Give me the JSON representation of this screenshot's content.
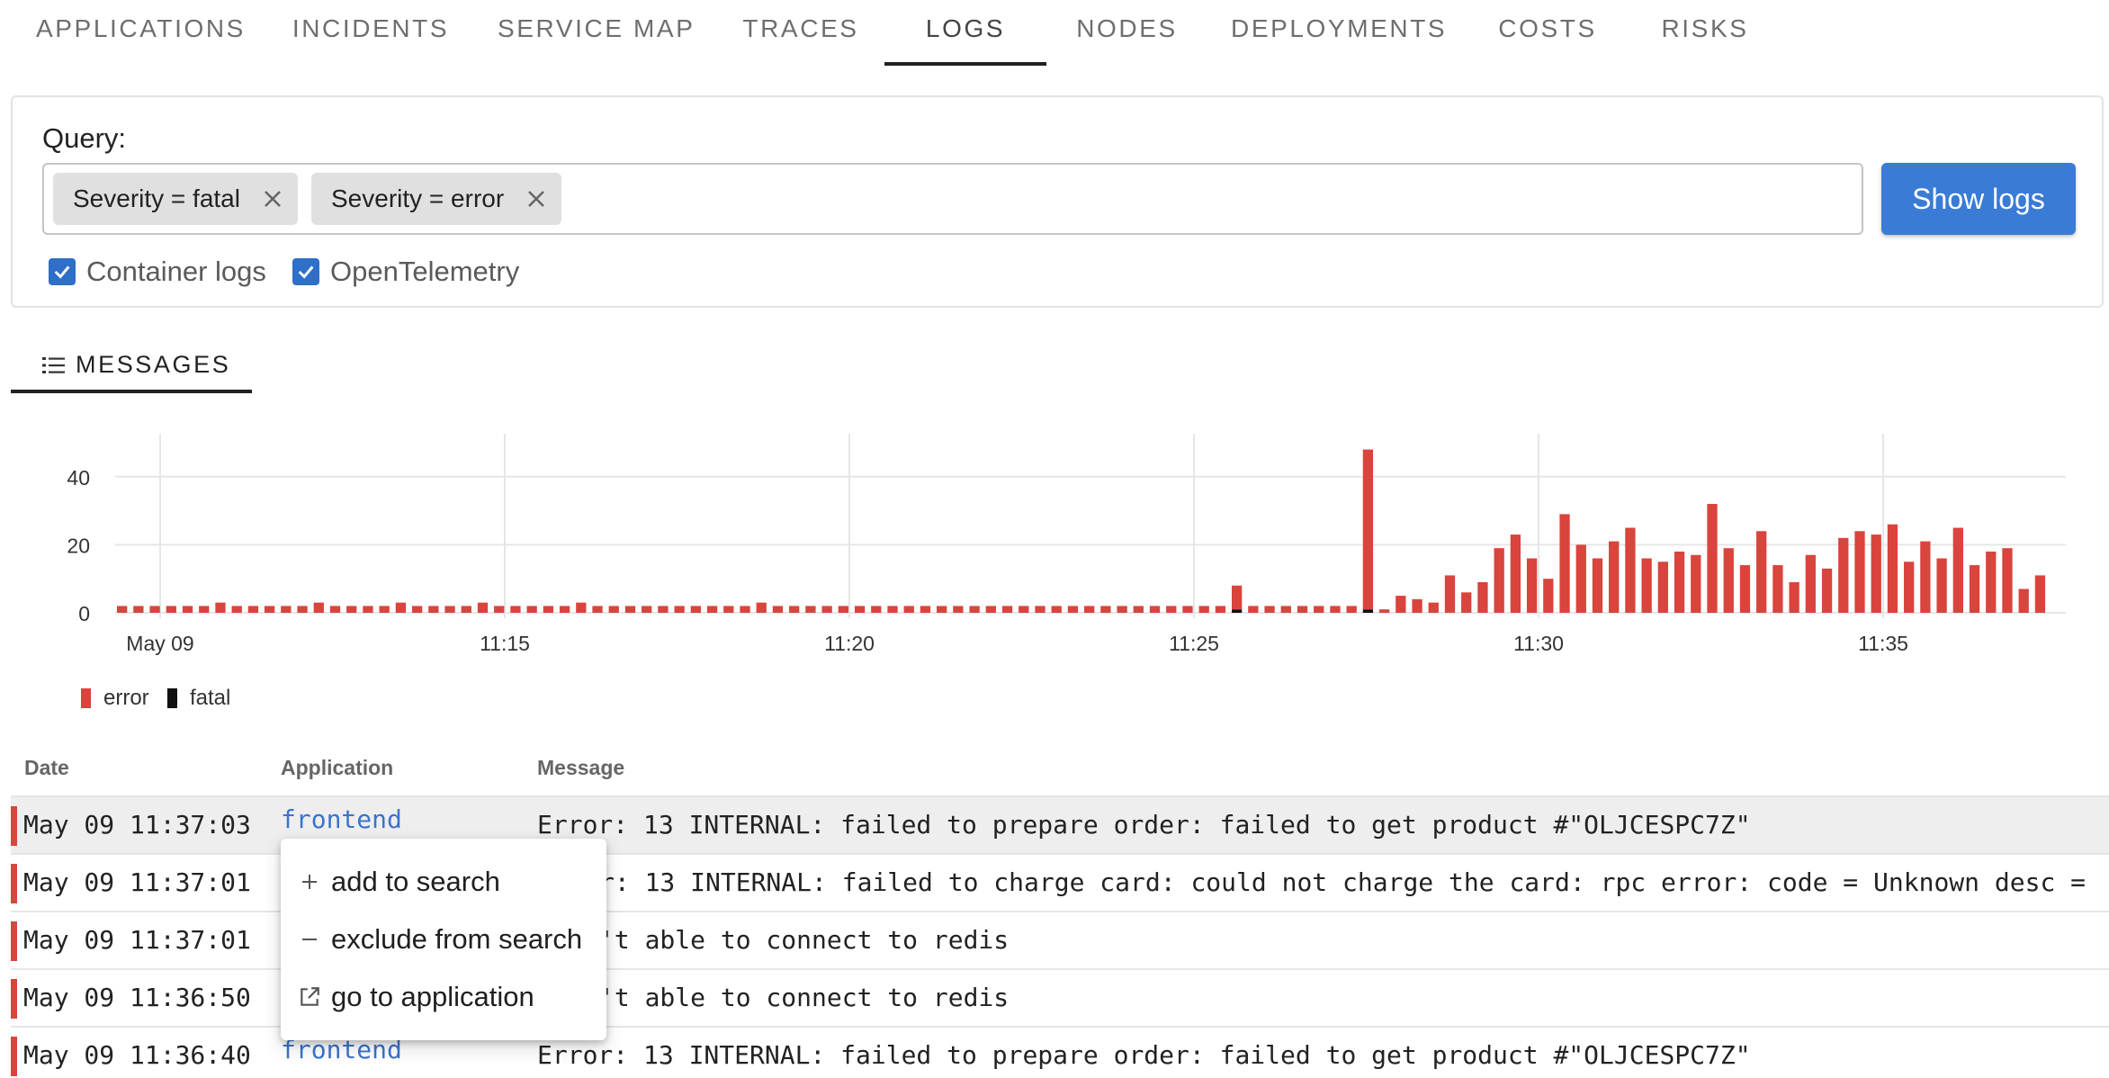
{
  "nav": {
    "tabs": [
      {
        "label": "APPLICATIONS"
      },
      {
        "label": "INCIDENTS"
      },
      {
        "label": "SERVICE MAP"
      },
      {
        "label": "TRACES"
      },
      {
        "label": "LOGS"
      },
      {
        "label": "NODES"
      },
      {
        "label": "DEPLOYMENTS"
      },
      {
        "label": "COSTS"
      },
      {
        "label": "RISKS"
      }
    ],
    "active_tab": "LOGS"
  },
  "query": {
    "label": "Query:",
    "chips": [
      {
        "label": "Severity = fatal"
      },
      {
        "label": "Severity = error"
      }
    ],
    "show_button": "Show logs",
    "checkboxes": [
      {
        "label": "Container logs",
        "checked": true
      },
      {
        "label": "OpenTelemetry",
        "checked": true
      }
    ]
  },
  "messages_tab": {
    "label": "MESSAGES"
  },
  "chart_data": {
    "type": "bar",
    "stacked": true,
    "ylim": [
      0,
      48
    ],
    "yticks": [
      0,
      20,
      40
    ],
    "x_tick_labels": [
      "May 09",
      "11:15",
      "11:20",
      "11:25",
      "11:30",
      "11:35"
    ],
    "categories_note": "",
    "series": [
      {
        "name": "error",
        "color": "#d9443d",
        "values": [
          2,
          2,
          2,
          2,
          2,
          2,
          3,
          2,
          2,
          2,
          2,
          2,
          3,
          2,
          2,
          2,
          2,
          3,
          2,
          2,
          2,
          2,
          3,
          2,
          2,
          2,
          2,
          2,
          3,
          2,
          2,
          2,
          2,
          2,
          2,
          2,
          2,
          2,
          2,
          3,
          2,
          2,
          2,
          2,
          2,
          2,
          2,
          2,
          2,
          2,
          2,
          2,
          2,
          2,
          2,
          2,
          2,
          2,
          2,
          2,
          2,
          2,
          2,
          2,
          2,
          2,
          2,
          2,
          7,
          2,
          2,
          2,
          2,
          2,
          2,
          2,
          47,
          1,
          5,
          4,
          3,
          11,
          6,
          9,
          19,
          23,
          16,
          10,
          29,
          20,
          16,
          21,
          25,
          16,
          15,
          18,
          17,
          32,
          19,
          14,
          24,
          14,
          9,
          17,
          13,
          22,
          24,
          23,
          26,
          15,
          21,
          16,
          25,
          14,
          18,
          19,
          7,
          11
        ]
      },
      {
        "name": "fatal",
        "color": "#111111",
        "values": [
          0,
          0,
          0,
          0,
          0,
          0,
          0,
          0,
          0,
          0,
          0,
          0,
          0,
          0,
          0,
          0,
          0,
          0,
          0,
          0,
          0,
          0,
          0,
          0,
          0,
          0,
          0,
          0,
          0,
          0,
          0,
          0,
          0,
          0,
          0,
          0,
          0,
          0,
          0,
          0,
          0,
          0,
          0,
          0,
          0,
          0,
          0,
          0,
          0,
          0,
          0,
          0,
          0,
          0,
          0,
          0,
          0,
          0,
          0,
          0,
          0,
          0,
          0,
          0,
          0,
          0,
          0,
          0,
          1,
          0,
          0,
          0,
          0,
          0,
          0,
          0,
          1,
          0,
          0,
          0,
          0,
          0,
          0,
          0,
          0,
          0,
          0,
          0,
          0,
          0,
          0,
          0,
          0,
          0,
          0,
          0,
          0,
          0,
          0,
          0,
          0,
          0,
          0,
          0,
          0,
          0,
          0,
          0,
          0,
          0,
          0,
          0,
          0,
          0,
          0,
          0,
          0,
          0
        ]
      }
    ],
    "legend": [
      "error",
      "fatal"
    ],
    "grid": true,
    "legend_position": "bottom-left"
  },
  "table": {
    "headers": {
      "date": "Date",
      "application": "Application",
      "message": "Message"
    },
    "rows": [
      {
        "date": "May 09 11:37:03",
        "application": "frontend",
        "message": "Error: 13 INTERNAL: failed to prepare order: failed to get product #\"OLJCESPC7Z\"",
        "severity_color": "#d9443d"
      },
      {
        "date": "May 09 11:37:01",
        "application": "",
        "message": "r: 13 INTERNAL: failed to charge card: could not charge the card: rpc error: code = Unknown desc =",
        "severity_color": "#d9443d"
      },
      {
        "date": "May 09 11:37:01",
        "application": "",
        "message": "'t able to connect to redis",
        "severity_color": "#d9443d"
      },
      {
        "date": "May 09 11:36:50",
        "application": "",
        "message": "'t able to connect to redis",
        "severity_color": "#d9443d"
      },
      {
        "date": "May 09 11:36:40",
        "application": "frontend",
        "message": "Error: 13 INTERNAL: failed to prepare order: failed to get product #\"OLJCESPC7Z\"",
        "severity_color": "#d9443d"
      }
    ]
  },
  "context_menu": {
    "items": [
      {
        "label": "add to search",
        "icon": "plus-icon"
      },
      {
        "label": "exclude from search",
        "icon": "minus-icon"
      },
      {
        "label": "go to application",
        "icon": "external-link-icon"
      }
    ]
  }
}
